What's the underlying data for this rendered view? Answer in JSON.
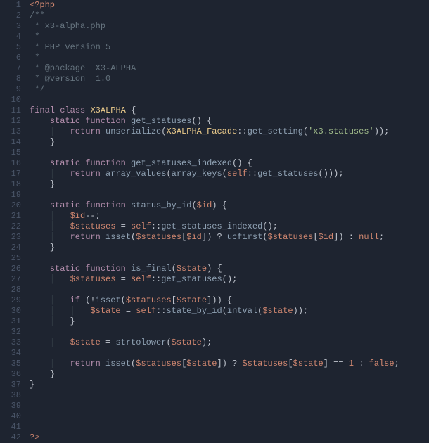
{
  "line_count": 42,
  "lines": {
    "l1": "<span class='tag'>&lt;?php</span>",
    "l2": "<span class='cmt'>/**</span>",
    "l3": "<span class='cmt'> * x3-alpha.php</span>",
    "l4": "<span class='cmt'> *</span>",
    "l5": "<span class='cmt'> * PHP version 5</span>",
    "l6": "<span class='cmt'> *</span>",
    "l7": "<span class='cmt'> * @package  X3-ALPHA</span>",
    "l8": "<span class='cmt'> * @version  1.0</span>",
    "l9": "<span class='cmt'> */</span>",
    "l10": "",
    "l11": "<span class='kw'>final</span> <span class='kw2'>class</span> <span class='type'>X3ALPHA</span> <span class='punc'>{</span>",
    "l12": "<span class='guide'>│   </span><span class='kw'>static</span> <span class='kw2'>function</span> <span class='fn'>get_statuses</span><span class='punc'>() {</span>",
    "l13": "<span class='guide'>│   │   </span><span class='kw'>return</span> <span class='call'>unserialize</span><span class='punc'>(</span><span class='type'>X3ALPHA_Facade</span><span class='op'>::</span><span class='call'>get_setting</span><span class='punc'>(</span><span class='str'>'x3.statuses'</span><span class='punc'>));</span>",
    "l14": "<span class='guide'>│   </span><span class='punc'>}</span>",
    "l15": "",
    "l16": "<span class='guide'>│   </span><span class='kw'>static</span> <span class='kw2'>function</span> <span class='fn'>get_statuses_indexed</span><span class='punc'>() {</span>",
    "l17": "<span class='guide'>│   │   </span><span class='kw'>return</span> <span class='call'>array_values</span><span class='punc'>(</span><span class='call'>array_keys</span><span class='punc'>(</span><span class='self'>self</span><span class='op'>::</span><span class='call'>get_statuses</span><span class='punc'>()));</span>",
    "l18": "<span class='guide'>│   </span><span class='punc'>}</span>",
    "l19": "",
    "l20": "<span class='guide'>│   </span><span class='kw'>static</span> <span class='kw2'>function</span> <span class='fn'>status_by_id</span><span class='punc'>(</span><span class='var'>$id</span><span class='punc'>) {</span>",
    "l21": "<span class='guide'>│   │   </span><span class='var'>$id</span><span class='op'>--</span><span class='punc'>;</span>",
    "l22": "<span class='guide'>│   │   </span><span class='var'>$statuses</span> <span class='op'>=</span> <span class='self'>self</span><span class='op'>::</span><span class='call'>get_statuses_indexed</span><span class='punc'>();</span>",
    "l23": "<span class='guide'>│   │   </span><span class='kw'>return</span> <span class='call'>isset</span><span class='punc'>(</span><span class='var'>$statuses</span><span class='punc'>[</span><span class='var'>$id</span><span class='punc'>]) ?</span> <span class='ucf'>ucfirst</span><span class='punc'>(</span><span class='var'>$statuses</span><span class='punc'>[</span><span class='var'>$id</span><span class='punc'>]) :</span> <span class='const'>null</span><span class='punc'>;</span>",
    "l24": "<span class='guide'>│   </span><span class='punc'>}</span>",
    "l25": "",
    "l26": "<span class='guide'>│   </span><span class='kw'>static</span> <span class='kw2'>function</span> <span class='fn'>is_final</span><span class='punc'>(</span><span class='var'>$state</span><span class='punc'>) {</span>",
    "l27": "<span class='guide'>│   │   </span><span class='var'>$statuses</span> <span class='op'>=</span> <span class='self'>self</span><span class='op'>::</span><span class='call'>get_statuses</span><span class='punc'>();</span>",
    "l28": "",
    "l29": "<span class='guide'>│   │   </span><span class='kw'>if</span> <span class='punc'>(</span><span class='op'>!</span><span class='call'>isset</span><span class='punc'>(</span><span class='var'>$statuses</span><span class='punc'>[</span><span class='var'>$state</span><span class='punc'>])) {</span>",
    "l30": "<span class='guide'>│   │   │   </span><span class='var'>$state</span> <span class='op'>=</span> <span class='self'>self</span><span class='op'>::</span><span class='call'>state_by_id</span><span class='punc'>(</span><span class='call'>intval</span><span class='punc'>(</span><span class='var'>$state</span><span class='punc'>));</span>",
    "l31": "<span class='guide'>│   │   </span><span class='punc'>}</span>",
    "l32": "",
    "l33": "<span class='guide'>│   │   </span><span class='var'>$state</span> <span class='op'>=</span> <span class='call'>strtolower</span><span class='punc'>(</span><span class='var'>$state</span><span class='punc'>);</span>",
    "l34": "",
    "l35": "<span class='guide'>│   │   </span><span class='kw'>return</span> <span class='call'>isset</span><span class='punc'>(</span><span class='var'>$statuses</span><span class='punc'>[</span><span class='var'>$state</span><span class='punc'>]) ?</span> <span class='var'>$statuses</span><span class='punc'>[</span><span class='var'>$state</span><span class='punc'>]</span> <span class='op'>==</span> <span class='num'>1</span> <span class='punc'>:</span> <span class='const'>false</span><span class='punc'>;</span>",
    "l36": "<span class='guide'>│   </span><span class='punc'>}</span>",
    "l37": "<span class='punc'>}</span>",
    "l38": "",
    "l39": "",
    "l40": "",
    "l41": "",
    "l42": "<span class='tag'>?&gt;</span>"
  }
}
